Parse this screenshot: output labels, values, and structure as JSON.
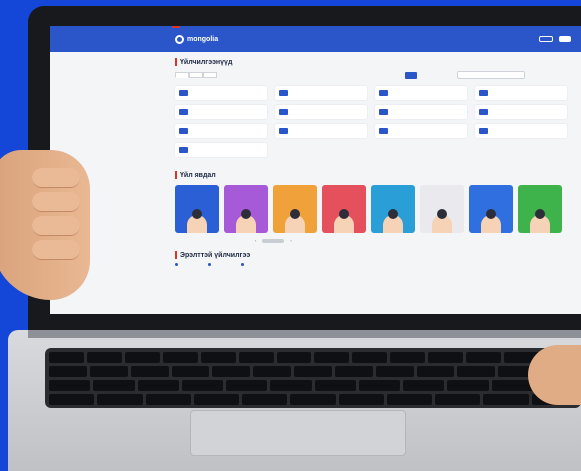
{
  "header": {
    "top_badge": "",
    "logo": "mongolia",
    "nav": [
      "",
      "",
      "",
      ""
    ],
    "login_label": "",
    "signup_label": ""
  },
  "services_section": {
    "title": "Үйлчилгээнүүд",
    "tabs": [
      "",
      "",
      ""
    ],
    "view_modes": [
      "",
      "",
      ""
    ],
    "search_placeholder": "",
    "items": [
      {
        "icon": "car-icon",
        "label": ""
      },
      {
        "icon": "card-icon",
        "label": ""
      },
      {
        "icon": "document-icon",
        "label": ""
      },
      {
        "icon": "family-icon",
        "label": ""
      },
      {
        "icon": "vehicle-icon",
        "label": ""
      },
      {
        "icon": "id-icon",
        "label": ""
      },
      {
        "icon": "location-icon",
        "label": ""
      },
      {
        "icon": "building-icon",
        "label": ""
      },
      {
        "icon": "folder-icon",
        "label": ""
      },
      {
        "icon": "truck-icon",
        "label": ""
      },
      {
        "icon": "car-icon",
        "label": ""
      },
      {
        "icon": "shield-icon",
        "label": ""
      },
      {
        "icon": "house-icon",
        "label": ""
      }
    ]
  },
  "life_section": {
    "title": "Үйл явдал",
    "cards": [
      {
        "color": "#2b5fd6",
        "title": ""
      },
      {
        "color": "#a65ad8",
        "title": ""
      },
      {
        "color": "#f0a13a",
        "title": ""
      },
      {
        "color": "#e5505d",
        "title": ""
      },
      {
        "color": "#2a9ed6",
        "title": ""
      },
      {
        "color": "#e9e9ee",
        "title": ""
      },
      {
        "color": "#2f6fe0",
        "title": ""
      },
      {
        "color": "#3fb34b",
        "title": ""
      }
    ],
    "pager": {
      "prev": "‹",
      "next": "›"
    }
  },
  "popular_section": {
    "title": "Эрэлттэй үйлчилгээ",
    "items": [
      "",
      "",
      ""
    ]
  }
}
